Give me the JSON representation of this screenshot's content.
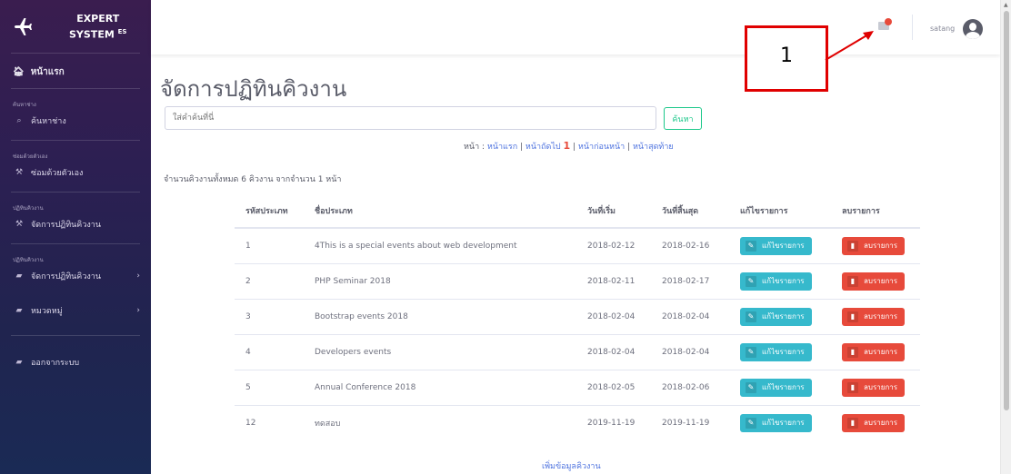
{
  "brand": {
    "line1": "EXPERT",
    "line2": "SYSTEM",
    "sup": "ES"
  },
  "sidebar": {
    "home": "หน้าแรก",
    "sections": [
      {
        "heading": "ค้นหาช่าง",
        "items": [
          {
            "label": "ค้นหาช่าง",
            "icon": "search-icon"
          }
        ]
      },
      {
        "heading": "ซ่อมด้วยตัวเอง",
        "items": [
          {
            "label": "ซ่อมด้วยตัวเอง",
            "icon": "wrench-icon"
          }
        ]
      },
      {
        "heading": "ปฏิทินคิวงาน",
        "items": [
          {
            "label": "จัดการปฏิทินคิวงาน",
            "icon": "wrench-icon"
          }
        ]
      },
      {
        "heading": "ปฏิทินคิวงาน",
        "items": [
          {
            "label": "จัดการปฏิทินคิวงาน",
            "icon": "folder-icon"
          },
          {
            "label": "หมวดหมู่",
            "icon": "folder-icon"
          }
        ]
      }
    ],
    "logout": "ออกจากระบบ"
  },
  "topbar": {
    "username": "satang"
  },
  "annotation": {
    "number": "1"
  },
  "main": {
    "title": "จัดการปฏิทินคิวงาน",
    "search_placeholder": "ใส่คำค้นที่นี่",
    "search_button": "ค้นหา",
    "pager": {
      "label": "หน้า :",
      "first": "หน้าแรก",
      "next": "หน้าถัดไป",
      "current": "1",
      "prev": "หน้าก่อนหน้า",
      "last": "หน้าสุดท้าย"
    },
    "summary": "จำนวนคิวงานทั้งหมด 6 คิวงาน จากจำนวน 1 หน้า",
    "columns": [
      "รหัสประเภท",
      "ชื่อประเภท",
      "วันที่เริ่ม",
      "วันที่สิ้นสุด",
      "แก้ไขรายการ",
      "ลบรายการ"
    ],
    "edit_label": "แก้ไขรายการ",
    "delete_label": "ลบรายการ",
    "rows": [
      {
        "id": "1",
        "name": "4This is a special events about web development",
        "start": "2018-02-12",
        "end": "2018-02-16"
      },
      {
        "id": "2",
        "name": "PHP Seminar 2018",
        "start": "2018-02-11",
        "end": "2018-02-17"
      },
      {
        "id": "3",
        "name": "Bootstrap events 2018",
        "start": "2018-02-04",
        "end": "2018-02-04"
      },
      {
        "id": "4",
        "name": "Developers events",
        "start": "2018-02-04",
        "end": "2018-02-04"
      },
      {
        "id": "5",
        "name": "Annual Conference 2018",
        "start": "2018-02-05",
        "end": "2018-02-06"
      },
      {
        "id": "12",
        "name": "ทดสอบ",
        "start": "2019-11-19",
        "end": "2019-11-19"
      }
    ],
    "add_link": "เพิ่มข้อมูลคิวงาน"
  },
  "colors": {
    "edit": "#36b9cc",
    "delete": "#e74a3b",
    "link": "#4e73df",
    "search_btn": "#1cc88a"
  }
}
